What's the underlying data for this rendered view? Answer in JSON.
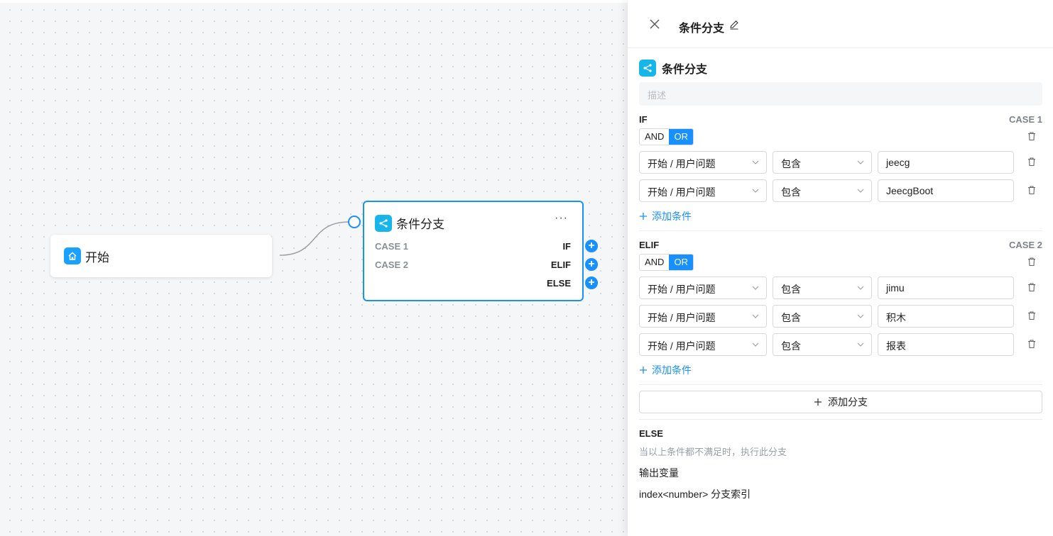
{
  "canvas": {
    "start_node": {
      "title": "开始",
      "icon": "home-icon"
    },
    "branch_node": {
      "title": "条件分支",
      "more": "···",
      "rows": [
        {
          "left": "CASE 1",
          "right": "IF"
        },
        {
          "left": "CASE 2",
          "right": "ELIF"
        },
        {
          "left": "",
          "right": "ELSE"
        }
      ],
      "port_symbol": "+"
    }
  },
  "drawer": {
    "title": "条件分支",
    "section_title": "条件分支",
    "description_placeholder": "描述",
    "and_label": "AND",
    "or_label": "OR",
    "add_condition": "添加条件",
    "add_branch": "添加分支",
    "branches": [
      {
        "type": "IF",
        "case": "CASE 1",
        "logic": "OR",
        "conditions": [
          {
            "variable": "开始 / 用户问题",
            "operator": "包含",
            "value": "jeecg"
          },
          {
            "variable": "开始 / 用户问题",
            "operator": "包含",
            "value": "JeecgBoot"
          }
        ]
      },
      {
        "type": "ELIF",
        "case": "CASE 2",
        "logic": "OR",
        "conditions": [
          {
            "variable": "开始 / 用户问题",
            "operator": "包含",
            "value": "jimu"
          },
          {
            "variable": "开始 / 用户问题",
            "operator": "包含",
            "value": "积木"
          },
          {
            "variable": "开始 / 用户问题",
            "operator": "包含",
            "value": "报表"
          }
        ]
      }
    ],
    "else": {
      "title": "ELSE",
      "description": "当以上条件都不满足时，执行此分支"
    },
    "output": {
      "title": "输出变量",
      "variable": "index<number> 分支索引"
    }
  },
  "colors": {
    "accent": "#1890ff",
    "node_icon_start": "#1aa0ff",
    "node_icon_branch": "#16b6e8"
  }
}
